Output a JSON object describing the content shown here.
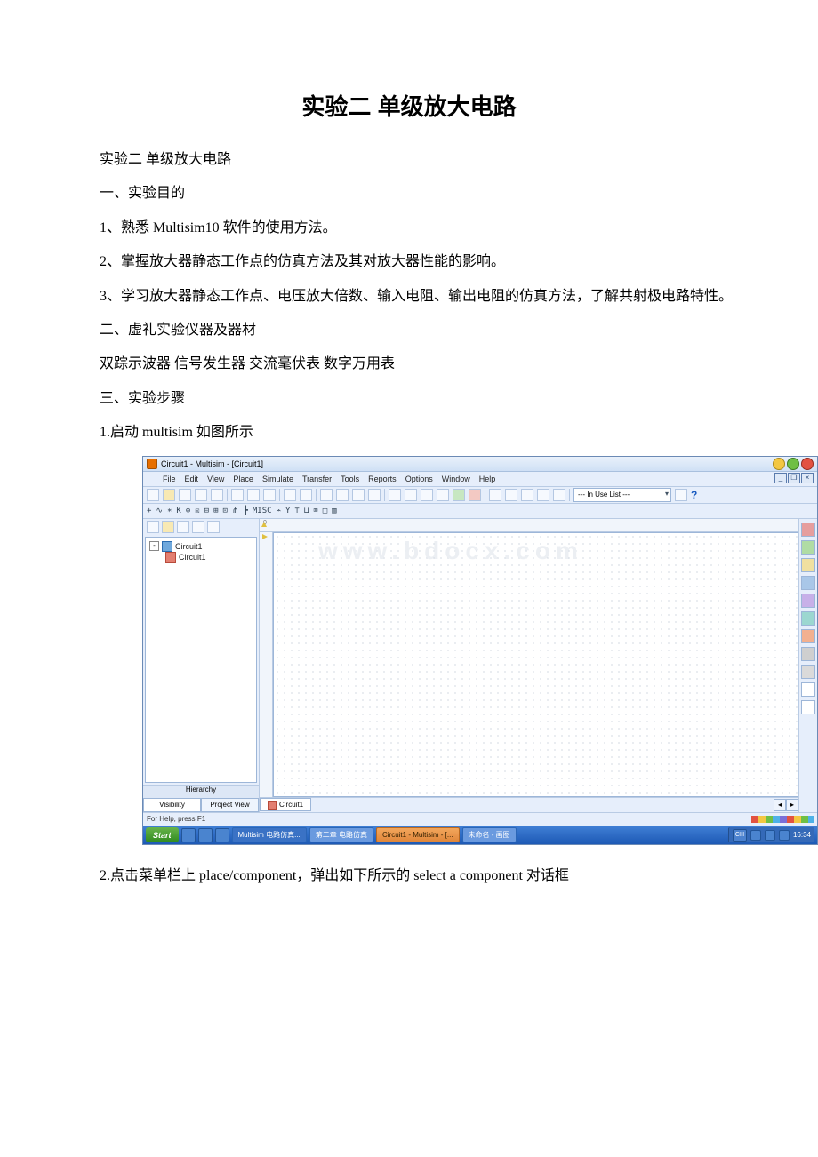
{
  "doc": {
    "title": "实验二 单级放大电路",
    "subtitle": "实验二 单级放大电路",
    "sec1_head": "一、实验目的",
    "sec1_1": "1、熟悉 Multisim10 软件的使用方法。",
    "sec1_2": "2、掌握放大器静态工作点的仿真方法及其对放大器性能的影响。",
    "sec1_3": "3、学习放大器静态工作点、电压放大倍数、输入电阻、输出电阻的仿真方法，了解共射极电路特性。",
    "sec2_head": "二、虚礼实验仪器及器材",
    "sec2_body": "双踪示波器  信号发生器  交流毫伏表  数字万用表",
    "sec3_head": "三、实验步骤",
    "step1": "1.启动 multisim 如图所示",
    "step2": "2.点击菜单栏上 place/component，弹出如下所示的 select a component 对话框"
  },
  "app": {
    "window_title": "Circuit1 - Multisim - [Circuit1]",
    "menus": [
      "File",
      "Edit",
      "View",
      "Place",
      "Simulate",
      "Transfer",
      "Tools",
      "Reports",
      "Options",
      "Window",
      "Help"
    ],
    "in_use_list": "--- In Use List ---",
    "watermark": "www.bdocx.com",
    "tree_root": "Circuit1",
    "tree_child": "Circuit1",
    "hierarchy_label": "Hierarchy",
    "left_tabs": [
      "Visibility",
      "Project View"
    ],
    "doc_tab": "Circuit1",
    "status_text": "For Help, press F1",
    "component_bar": [
      "+",
      "∿",
      "∗",
      "K",
      "⊕",
      "☒",
      "⊟",
      "⊞",
      "⊡",
      "⋔",
      "┣",
      "MISC",
      "⌁",
      "Y",
      "⊤",
      "⊔",
      "⌧",
      "□",
      "▥"
    ]
  },
  "taskbar": {
    "start": "Start",
    "items": [
      {
        "label": "Multisim 电路仿真...",
        "active": false
      },
      {
        "label": "第二章 电路仿真",
        "active": false
      },
      {
        "label": "Circuit1 - Multisim - [...",
        "active": true
      },
      {
        "label": "未命名 - 画图",
        "active": false
      }
    ],
    "lang": "CH",
    "clock": "16:34"
  }
}
